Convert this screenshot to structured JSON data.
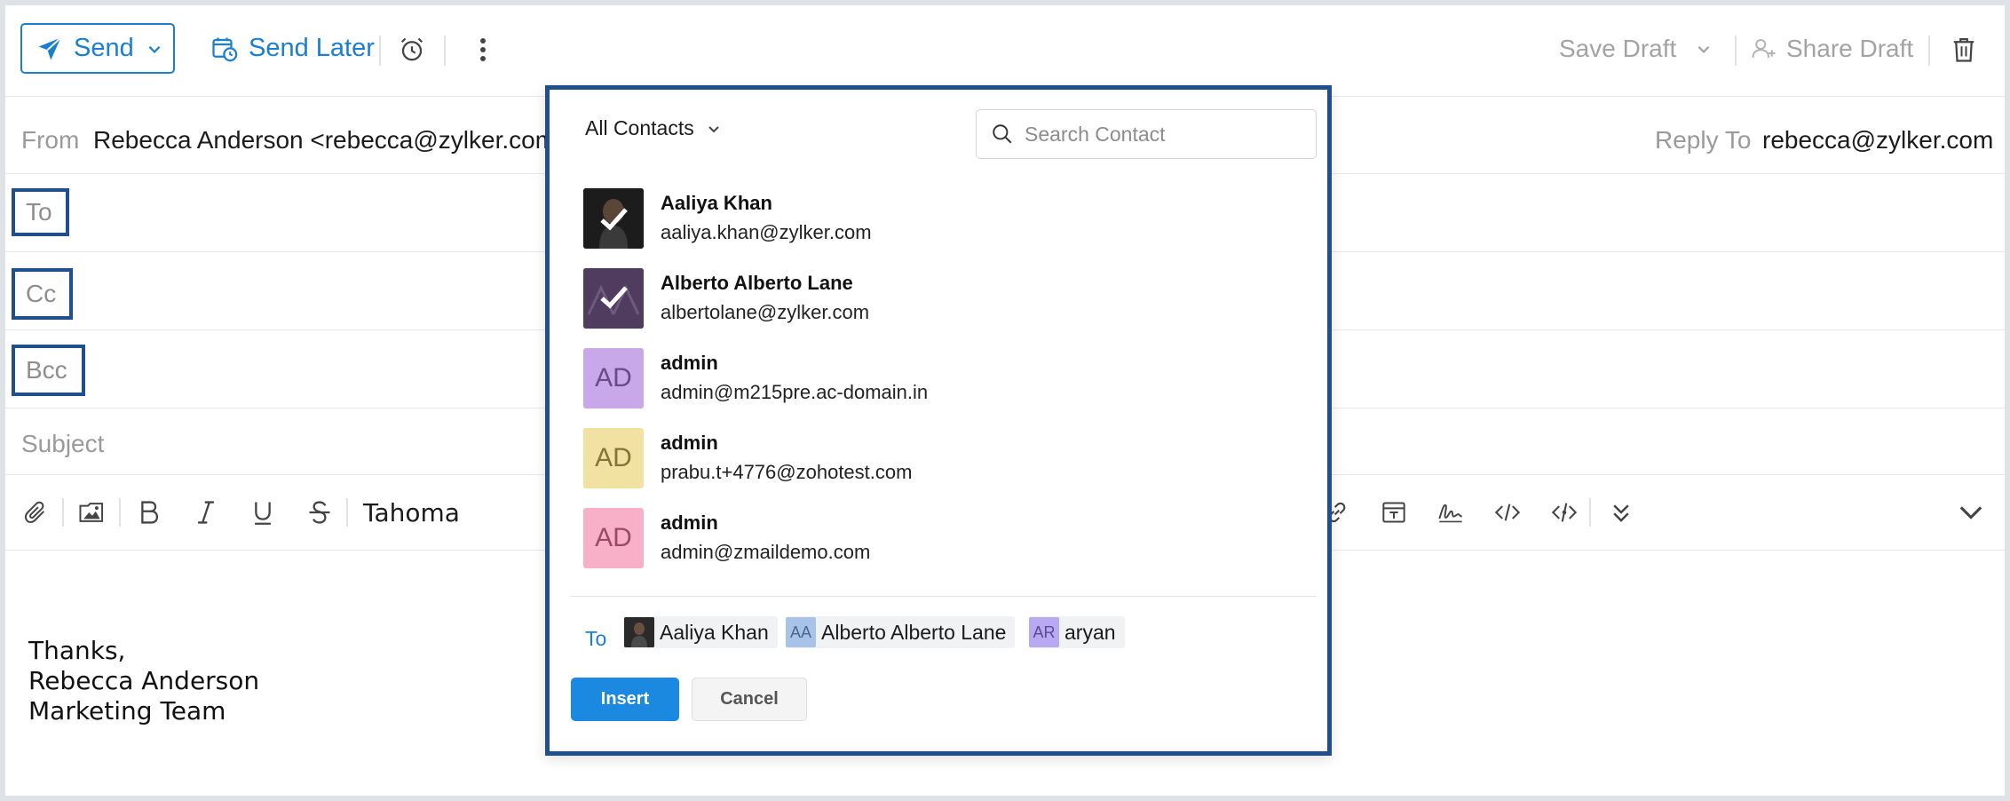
{
  "toolbar": {
    "send_label": "Send",
    "send_later_label": "Send Later",
    "save_draft_label": "Save Draft",
    "share_draft_label": "Share Draft"
  },
  "from": {
    "label": "From",
    "value": "Rebecca Anderson <rebecca@zylker.com"
  },
  "reply_to": {
    "label": "Reply To",
    "value": "rebecca@zylker.com"
  },
  "fields": {
    "to": "To",
    "cc": "Cc",
    "bcc": "Bcc",
    "subject": "Subject"
  },
  "format_bar": {
    "font": "Tahoma"
  },
  "body": {
    "signature": [
      "Thanks,",
      "Rebecca Anderson",
      "Marketing Team"
    ]
  },
  "picker": {
    "filter_label": "All Contacts",
    "search_placeholder": "Search Contact",
    "contacts": [
      {
        "name": "Aaliya Khan",
        "email": "aaliya.khan@zylker.com",
        "initials": "",
        "selected": true,
        "color": "#222222"
      },
      {
        "name": "Alberto Alberto Lane",
        "email": "albertolane@zylker.com",
        "initials": "",
        "selected": true,
        "color": "#4f3c5e"
      },
      {
        "name": "admin",
        "email": "admin@m215pre.ac-domain.in",
        "initials": "AD",
        "selected": false,
        "color": "#c9a8ea"
      },
      {
        "name": "admin",
        "email": "prabu.t+4776@zohotest.com",
        "initials": "AD",
        "selected": false,
        "color": "#f1e2a2"
      },
      {
        "name": "admin",
        "email": "admin@zmaildemo.com",
        "initials": "AD",
        "selected": false,
        "color": "#f8b0c8"
      }
    ],
    "to_label": "To",
    "recipients": [
      {
        "name": "Aaliya Khan",
        "initials": "",
        "color": "#333333"
      },
      {
        "name": "Alberto Alberto Lane",
        "initials": "AA",
        "color": "#a9c2e8"
      },
      {
        "name": "aryan",
        "initials": "AR",
        "color": "#b8a9f0"
      }
    ],
    "insert_label": "Insert",
    "cancel_label": "Cancel"
  },
  "colors": {
    "accent": "#1a7fd0",
    "highlight_border": "#1f4f8d",
    "insert_button": "#1a89df"
  }
}
